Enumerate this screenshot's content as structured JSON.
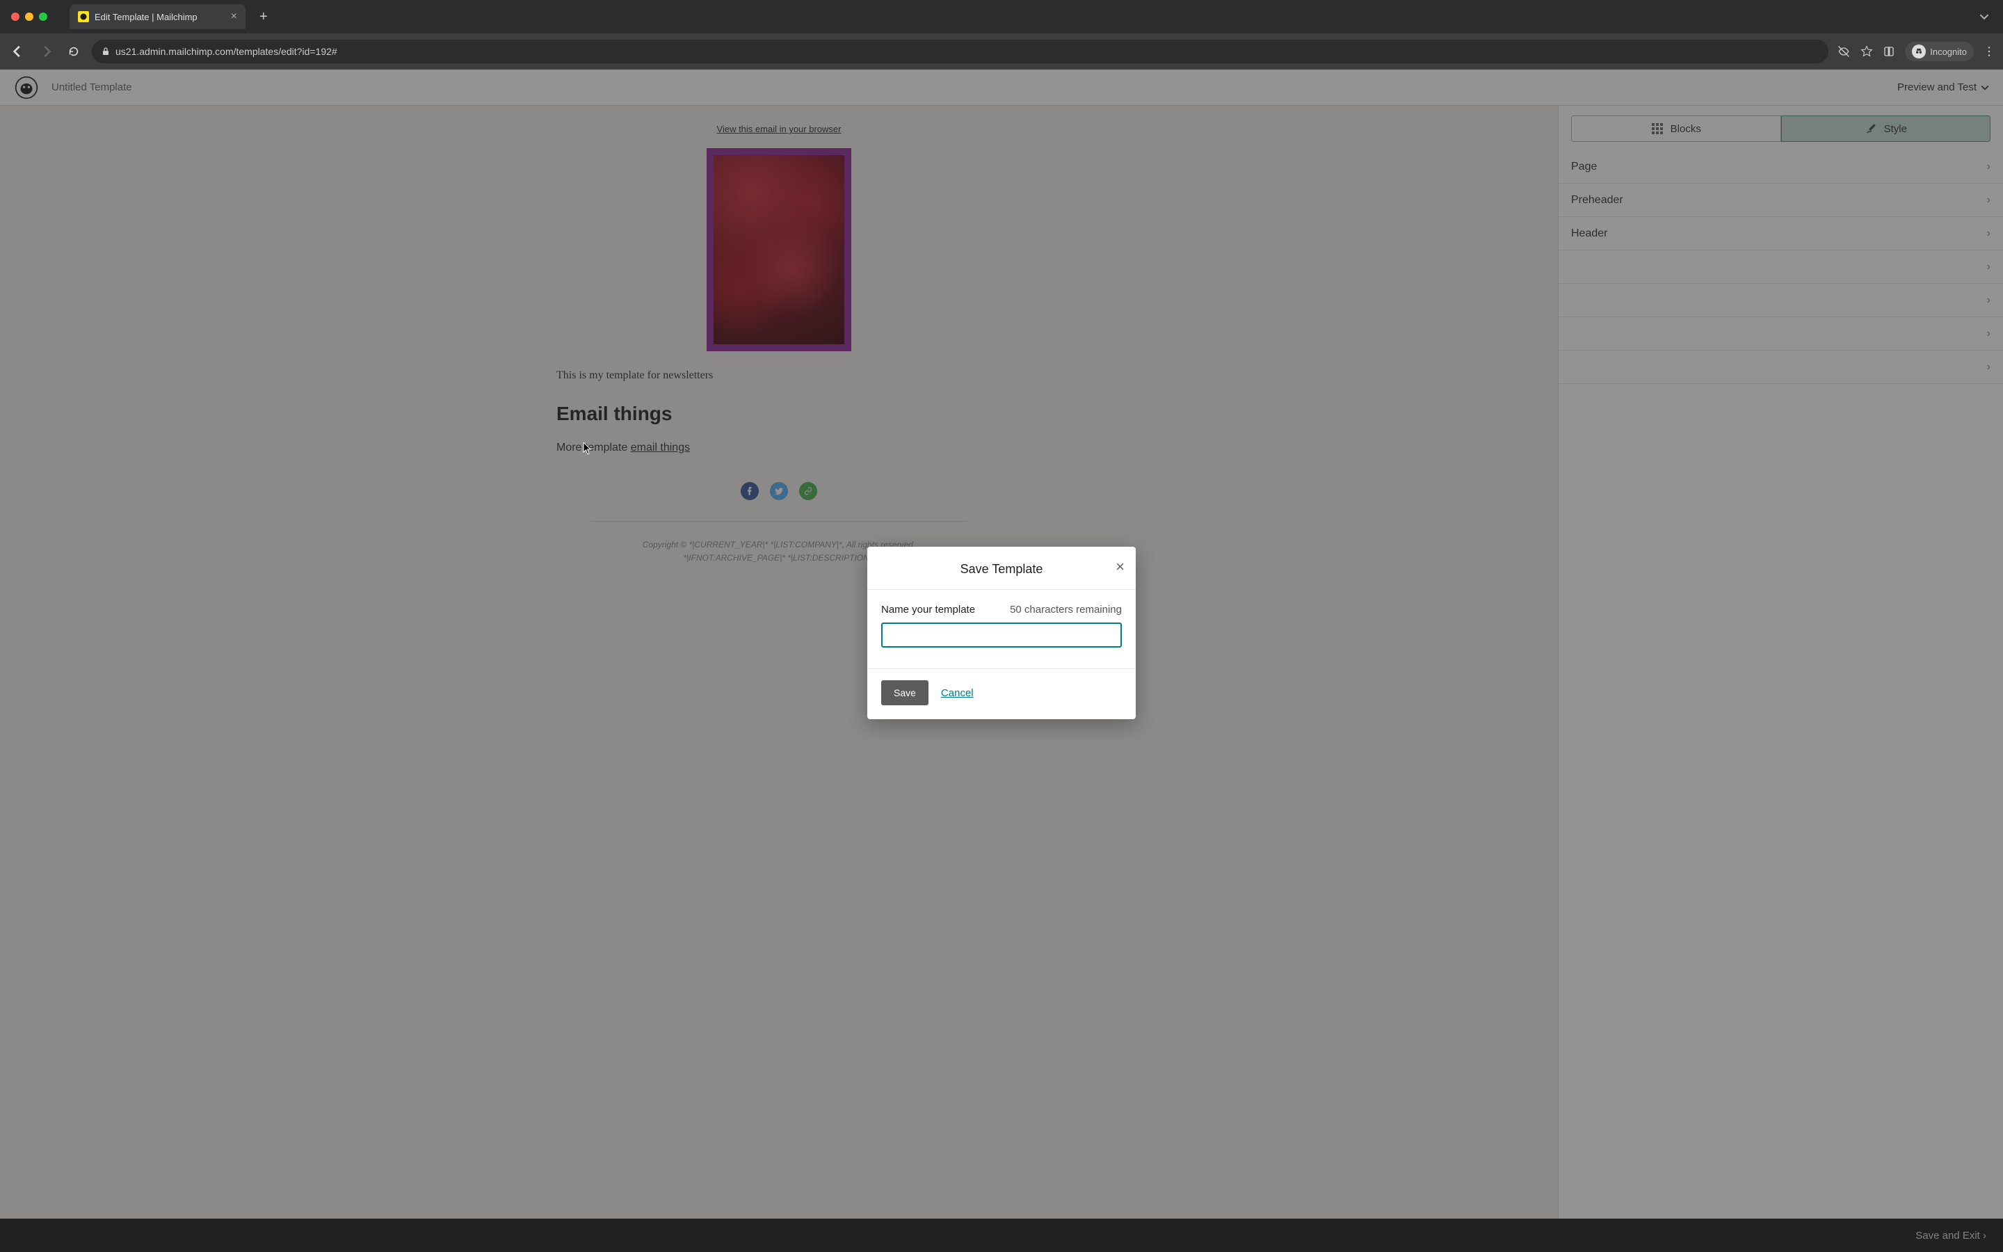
{
  "browser": {
    "tab_title": "Edit Template | Mailchimp",
    "url": "us21.admin.mailchimp.com/templates/edit?id=192#",
    "incognito_label": "Incognito"
  },
  "header": {
    "template_name": "Untitled Template",
    "preview_label": "Preview and Test"
  },
  "email": {
    "view_link": "View this email in your browser",
    "intro_text": "This is my template for newsletters",
    "heading": "Email things",
    "para_prefix": "More template ",
    "para_link": "email things",
    "copyright_line1": "Copyright © *|CURRENT_YEAR|* *|LIST:COMPANY|*, All rights reserved.",
    "copyright_line2": "*|IFNOT:ARCHIVE_PAGE|* *|LIST:DESCRIPTION|*"
  },
  "sidepanel": {
    "tab_blocks": "Blocks",
    "tab_style": "Style",
    "sections": [
      "Page",
      "Preheader",
      "Header",
      "",
      "",
      "",
      ""
    ]
  },
  "modal": {
    "title": "Save Template",
    "label": "Name your template",
    "remaining": "50 characters remaining",
    "input_value": "",
    "save": "Save",
    "cancel": "Cancel"
  },
  "footer": {
    "save_exit": "Save and Exit"
  }
}
